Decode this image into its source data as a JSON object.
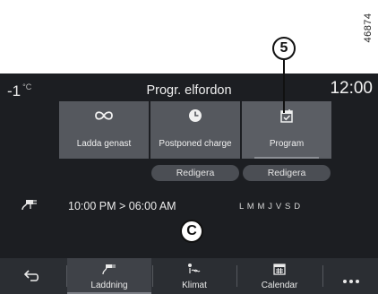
{
  "figure": {
    "reference_number": "46874",
    "callout_label": "5",
    "center_label": "C"
  },
  "header": {
    "temperature": "-1",
    "temperature_unit": "°C",
    "title": "Progr. elfordon",
    "time": "12:00"
  },
  "modes": [
    {
      "label": "Ladda genast",
      "icon": "infinity-icon",
      "selected": false
    },
    {
      "label": "Postponed charge",
      "icon": "clock-icon",
      "selected": false
    },
    {
      "label": "Program",
      "icon": "calendar-check-icon",
      "selected": true
    }
  ],
  "edit_buttons": [
    {
      "label": "Redigera"
    },
    {
      "label": "Redigera"
    }
  ],
  "schedule": {
    "icon": "charging-plug-icon",
    "time_range": "10:00 PM > 06:00 AM",
    "days": "L M M J V S D"
  },
  "bottom_nav": {
    "back_icon": "back-arrow-icon",
    "items": [
      {
        "label": "Laddning",
        "icon": "charging-icon",
        "active": true
      },
      {
        "label": "Klimat",
        "icon": "climate-icon",
        "active": false
      },
      {
        "label": "Calendar",
        "icon": "calendar-icon",
        "active": false
      }
    ],
    "more_icon": "more-icon"
  },
  "colors": {
    "screen_background": "#1c1e22",
    "tile_background": "#55585e",
    "button_background": "#4b4e54",
    "bottom_bar": "#2b2e33"
  }
}
